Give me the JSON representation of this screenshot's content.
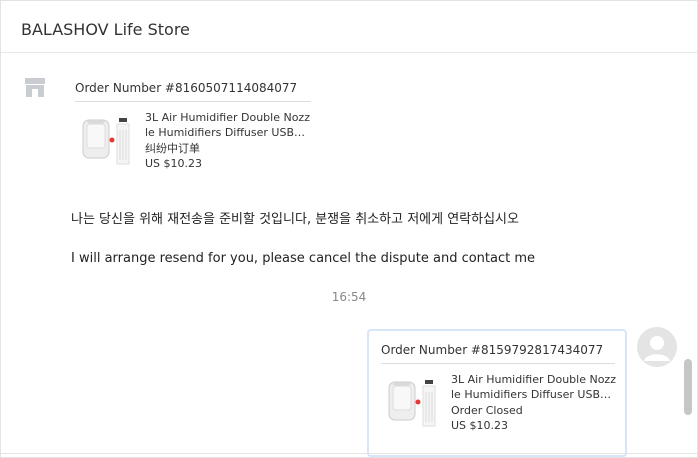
{
  "header": {
    "title": "BALASHOV Life Store"
  },
  "store_avatar": {
    "icon": "store-icon"
  },
  "messages": [
    {
      "type": "order_card",
      "order_number": "Order Number #8160507114084077",
      "product_title": "3L Air Humidifier Double Nozzle Humidifiers Diffuser USB…",
      "status": "纠纷中订单",
      "price": "US $10.23"
    },
    {
      "type": "text",
      "text": "나는 당신을 위해 재전송을 준비할 것입니다, 분쟁을 취소하고 저에게 연락하십시오"
    },
    {
      "type": "text",
      "text": "I will arrange resend for you, please cancel the dispute and contact me"
    }
  ],
  "timestamp": "16:54",
  "my_message": {
    "type": "order_card",
    "order_number": "Order Number #8159792817434077",
    "product_title": "3L Air Humidifier Double Nozzle Humidifiers Diffuser USB…",
    "status": "Order Closed",
    "price": "US $10.23"
  },
  "my_avatar": {
    "icon": "user-avatar-icon"
  }
}
